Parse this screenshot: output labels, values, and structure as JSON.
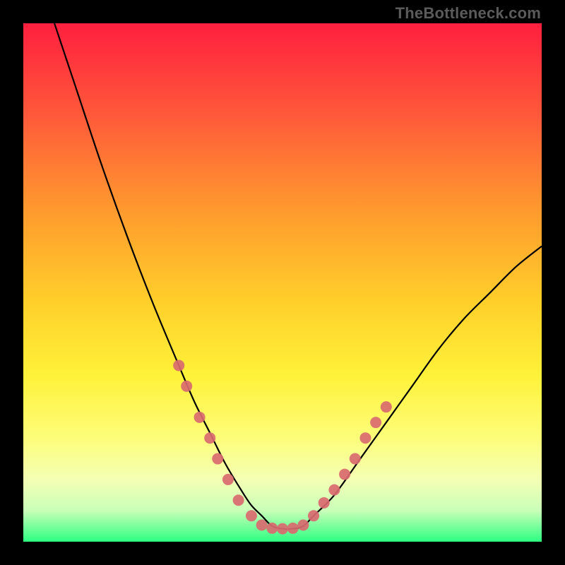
{
  "watermark": "TheBottleneck.com",
  "colors": {
    "gradient": [
      "#ff1f3f",
      "#ff5a3a",
      "#ff9a2e",
      "#ffd02a",
      "#fff23a",
      "#fdfd7a",
      "#f4ffb4",
      "#c9ffb8",
      "#2cff82"
    ],
    "curve": "#000000",
    "dot": "#d96a6f",
    "frame": "#000000"
  },
  "chart_data": {
    "type": "line",
    "title": "",
    "xlabel": "",
    "ylabel": "",
    "xlim": [
      0,
      100
    ],
    "ylim": [
      0,
      100
    ],
    "grid": false,
    "legend": false,
    "series": [
      {
        "name": "bottleneck-curve",
        "x": [
          6,
          10,
          15,
          20,
          25,
          30,
          33,
          36,
          39,
          42,
          44,
          46,
          48,
          50,
          52,
          54,
          56,
          60,
          65,
          70,
          75,
          80,
          85,
          90,
          95,
          100
        ],
        "y": [
          100,
          88,
          73,
          59,
          46,
          34,
          27,
          21,
          15,
          10,
          7,
          5,
          3,
          2.5,
          2.5,
          3,
          5,
          9,
          16,
          23,
          30,
          37,
          43,
          48,
          53,
          57
        ]
      }
    ],
    "annotations": {
      "type": "dots",
      "name": "highlight-dots",
      "points": [
        {
          "x": 30,
          "y": 34
        },
        {
          "x": 31.5,
          "y": 30
        },
        {
          "x": 34,
          "y": 24
        },
        {
          "x": 36,
          "y": 20
        },
        {
          "x": 37.5,
          "y": 16
        },
        {
          "x": 39.5,
          "y": 12
        },
        {
          "x": 41.5,
          "y": 8
        },
        {
          "x": 44,
          "y": 5
        },
        {
          "x": 46,
          "y": 3.2
        },
        {
          "x": 48,
          "y": 2.6
        },
        {
          "x": 50,
          "y": 2.5
        },
        {
          "x": 52,
          "y": 2.6
        },
        {
          "x": 54,
          "y": 3.2
        },
        {
          "x": 56,
          "y": 5
        },
        {
          "x": 58,
          "y": 7.5
        },
        {
          "x": 60,
          "y": 10
        },
        {
          "x": 62,
          "y": 13
        },
        {
          "x": 64,
          "y": 16
        },
        {
          "x": 66,
          "y": 20
        },
        {
          "x": 68,
          "y": 23
        },
        {
          "x": 70,
          "y": 26
        }
      ]
    }
  }
}
